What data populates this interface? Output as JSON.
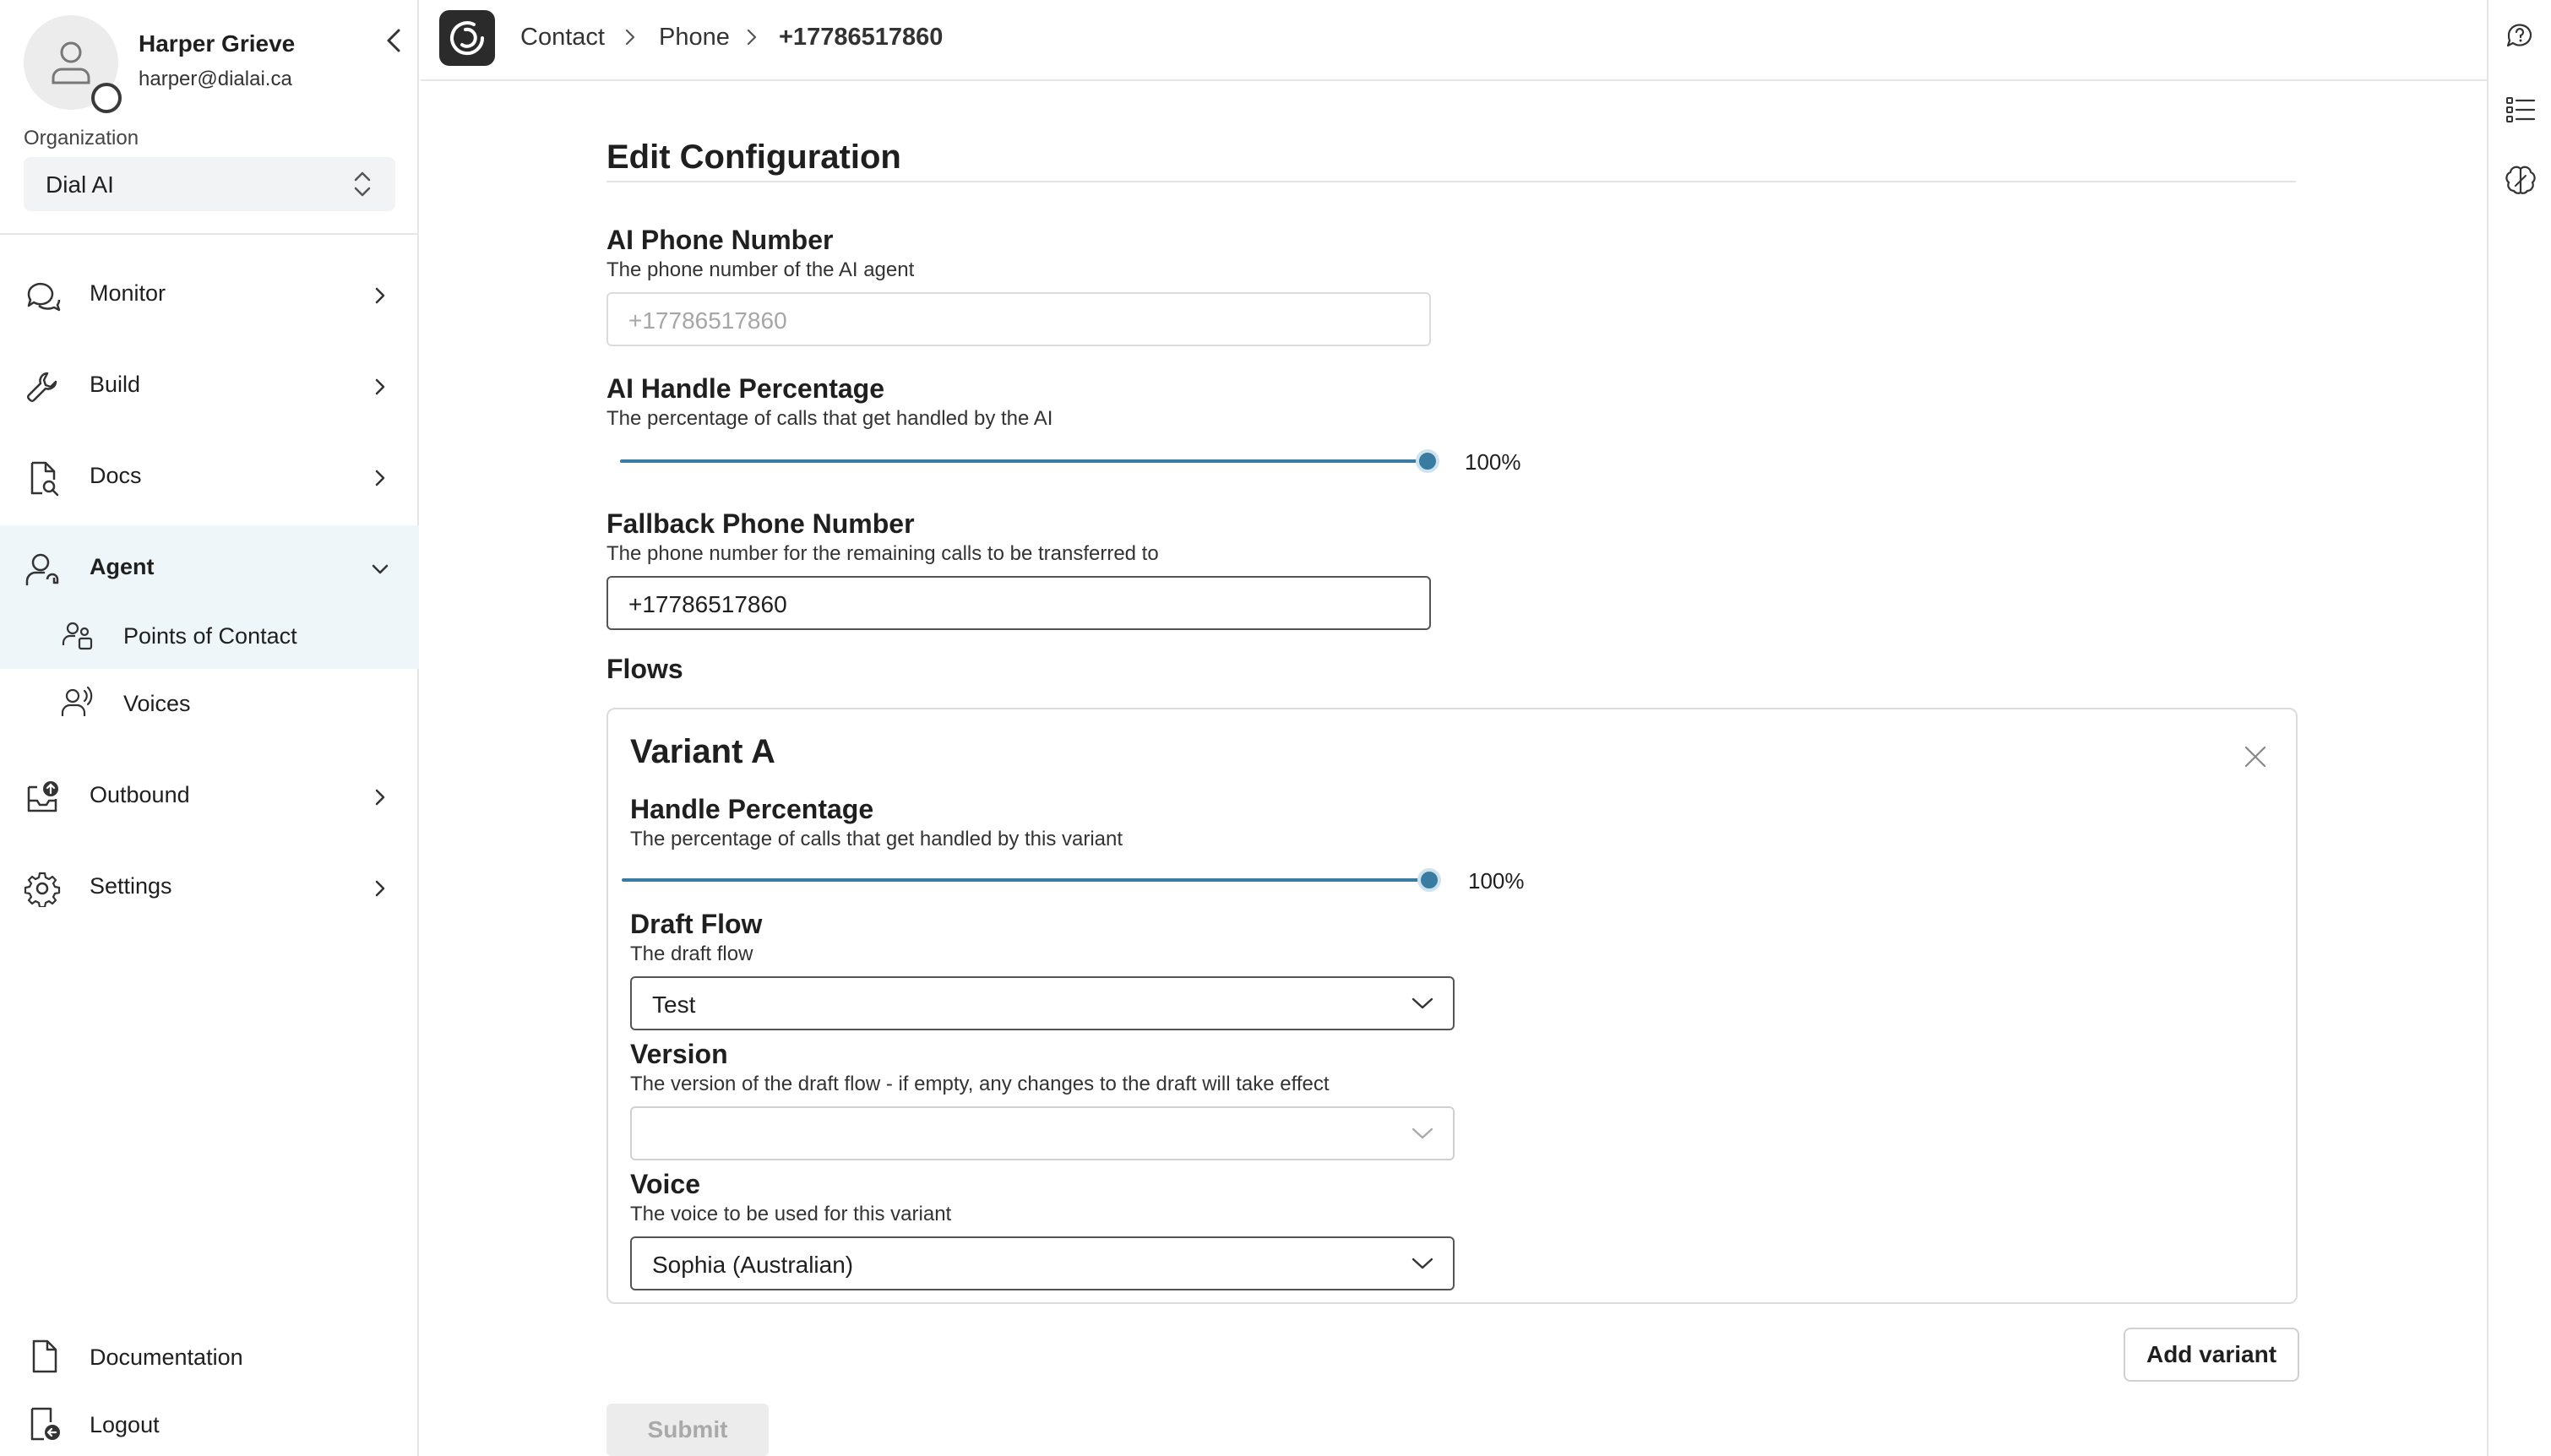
{
  "user": {
    "name": "Harper Grieve",
    "email": "harper@dialai.ca"
  },
  "organization": {
    "label": "Organization",
    "selected": "Dial AI"
  },
  "nav": {
    "monitor": "Monitor",
    "build": "Build",
    "docs": "Docs",
    "agent": "Agent",
    "agent_sub": {
      "points_of_contact": "Points of Contact",
      "voices": "Voices"
    },
    "outbound": "Outbound",
    "settings": "Settings"
  },
  "bottom_nav": {
    "documentation": "Documentation",
    "logout": "Logout"
  },
  "breadcrumb": {
    "items": [
      "Contact",
      "Phone",
      "+17786517860"
    ]
  },
  "form": {
    "title": "Edit Configuration",
    "ai_phone": {
      "label": "AI Phone Number",
      "help": "The phone number of the AI agent",
      "placeholder": "+17786517860"
    },
    "ai_handle": {
      "label": "AI Handle Percentage",
      "help": "The percentage of calls that get handled by the AI",
      "value": 100,
      "display": "100%"
    },
    "fallback_phone": {
      "label": "Fallback Phone Number",
      "help": "The phone number for the remaining calls to be transferred to",
      "value": "+17786517860"
    },
    "flows_label": "Flows",
    "variant": {
      "title": "Variant A",
      "handle": {
        "label": "Handle Percentage",
        "help": "The percentage of calls that get handled by this variant",
        "value": 100,
        "display": "100%"
      },
      "draft_flow": {
        "label": "Draft Flow",
        "help": "The draft flow",
        "selected": "Test"
      },
      "version": {
        "label": "Version",
        "help": "The version of the draft flow - if empty, any changes to the draft will take effect",
        "selected": ""
      },
      "voice": {
        "label": "Voice",
        "help": "The voice to be used for this variant",
        "selected": "Sophia (Australian)"
      }
    },
    "add_variant_label": "Add variant",
    "submit_label": "Submit"
  },
  "colors": {
    "accent": "#3a7ba1",
    "active_bg": "#eef6fa",
    "logo_bg": "#2b2b2b"
  },
  "icons": {
    "monitor": "chat-bubble-icon",
    "build": "wrench-icon",
    "docs": "document-search-icon",
    "agent": "person-headset-icon",
    "points_of_contact": "contacts-icon",
    "voices": "voice-person-icon",
    "outbound": "outbox-icon",
    "settings": "gear-icon",
    "documentation": "document-icon",
    "logout": "logout-icon",
    "rail": [
      "help-chat-icon",
      "list-icon",
      "brain-icon"
    ]
  }
}
